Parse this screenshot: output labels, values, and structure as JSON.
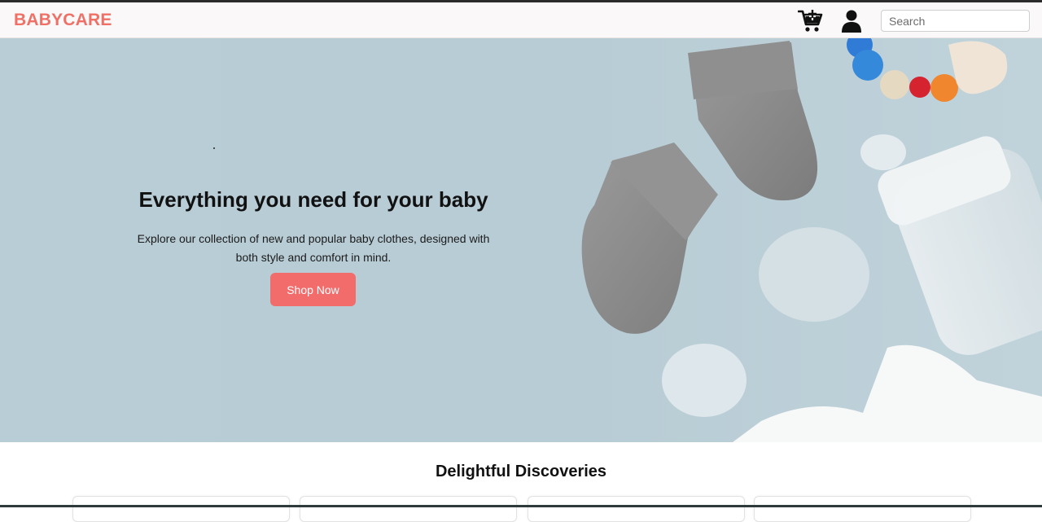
{
  "header": {
    "brand": "BABYCARE",
    "cart_icon": "cart-add-icon",
    "user_icon": "user-icon",
    "search": {
      "placeholder": "Search",
      "value": ""
    }
  },
  "hero": {
    "title": "Everything you need for your baby",
    "subtitle": "Explore our collection of new and popular baby clothes, designed with both style and comfort in mind.",
    "cta_label": "Shop Now"
  },
  "section": {
    "title": "Delightful Discoveries",
    "cards": [
      {},
      {},
      {},
      {}
    ]
  },
  "colors": {
    "brand": "#ef7067",
    "cta": "#f26c6c",
    "hero_background": "#b9cdd6"
  }
}
